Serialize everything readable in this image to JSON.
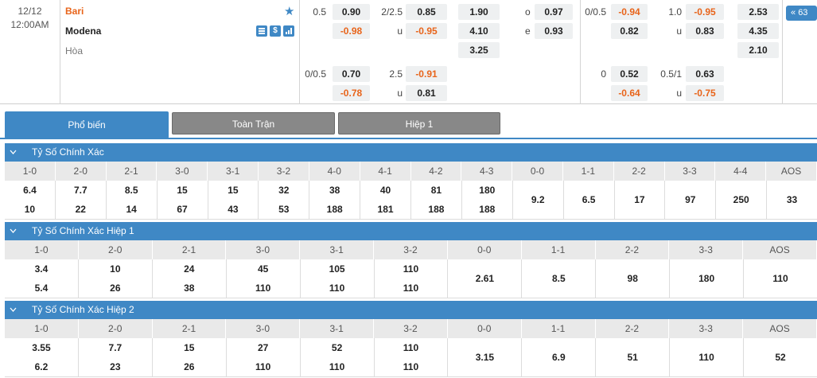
{
  "match": {
    "date": "12/12",
    "time": "12:00AM",
    "home": "Bari",
    "away": "Modena",
    "draw": "Hòa",
    "more_count": "63",
    "ft_handicap": [
      {
        "line": "0.5",
        "home": "0.90",
        "away": "-0.98"
      },
      {
        "line": "0/0.5",
        "home": "0.70",
        "away": "-0.78"
      }
    ],
    "ft_ou": [
      {
        "line": "2/2.5",
        "over": "0.85",
        "side_u": "u",
        "under": "-0.95"
      },
      {
        "line": "2.5",
        "over": "-0.91",
        "side_u": "u",
        "under": "0.81"
      }
    ],
    "ft_1x2": [
      "1.90",
      "4.10",
      "3.25"
    ],
    "ft_oe": {
      "o_label": "o",
      "o_val": "0.97",
      "e_label": "e",
      "e_val": "0.93"
    },
    "h1_handicap": [
      {
        "line": "0/0.5",
        "home": "-0.94",
        "away": "0.82"
      },
      {
        "line": "0",
        "home": "0.52",
        "away": "-0.64"
      }
    ],
    "h1_ou": [
      {
        "line": "1.0",
        "over": "-0.95",
        "side_u": "u",
        "under": "0.83"
      },
      {
        "line": "0.5/1",
        "over": "0.63",
        "side_u": "u",
        "under": "-0.75"
      }
    ],
    "h1_1x2": [
      "2.53",
      "4.35",
      "2.10"
    ]
  },
  "tabs": [
    "Phổ biến",
    "Toàn Trận",
    "Hiệp 1"
  ],
  "sections": [
    {
      "title": "Tỷ Số Chính Xác",
      "headers": [
        "1-0",
        "2-0",
        "2-1",
        "3-0",
        "3-1",
        "3-2",
        "4-0",
        "4-1",
        "4-2",
        "4-3",
        "0-0",
        "1-1",
        "2-2",
        "3-3",
        "4-4",
        "AOS"
      ],
      "values": [
        [
          "6.4",
          "10"
        ],
        [
          "7.7",
          "22"
        ],
        [
          "8.5",
          "14"
        ],
        [
          "15",
          "67"
        ],
        [
          "15",
          "43"
        ],
        [
          "32",
          "53"
        ],
        [
          "38",
          "188"
        ],
        [
          "40",
          "181"
        ],
        [
          "81",
          "188"
        ],
        [
          "180",
          "188"
        ],
        [
          "9.2"
        ],
        [
          "6.5"
        ],
        [
          "17"
        ],
        [
          "97"
        ],
        [
          "250"
        ],
        [
          "33"
        ]
      ]
    },
    {
      "title": "Tỷ Số Chính Xác Hiệp 1",
      "headers": [
        "1-0",
        "2-0",
        "2-1",
        "3-0",
        "3-1",
        "3-2",
        "0-0",
        "1-1",
        "2-2",
        "3-3",
        "AOS"
      ],
      "values": [
        [
          "3.4",
          "5.4"
        ],
        [
          "10",
          "26"
        ],
        [
          "24",
          "38"
        ],
        [
          "45",
          "110"
        ],
        [
          "105",
          "110"
        ],
        [
          "110",
          "110"
        ],
        [
          "2.61"
        ],
        [
          "8.5"
        ],
        [
          "98"
        ],
        [
          "180"
        ],
        [
          "110"
        ]
      ]
    },
    {
      "title": "Tỷ Số Chính Xác Hiệp 2",
      "headers": [
        "1-0",
        "2-0",
        "2-1",
        "3-0",
        "3-1",
        "3-2",
        "0-0",
        "1-1",
        "2-2",
        "3-3",
        "AOS"
      ],
      "values": [
        [
          "3.55",
          "6.2"
        ],
        [
          "7.7",
          "23"
        ],
        [
          "15",
          "26"
        ],
        [
          "27",
          "110"
        ],
        [
          "52",
          "110"
        ],
        [
          "110",
          "110"
        ],
        [
          "3.15"
        ],
        [
          "6.9"
        ],
        [
          "51"
        ],
        [
          "110"
        ],
        [
          "52"
        ]
      ]
    }
  ],
  "colors": {
    "accent": "#3f88c5",
    "negative": "#e8641a",
    "home_team": "#e8641a"
  }
}
